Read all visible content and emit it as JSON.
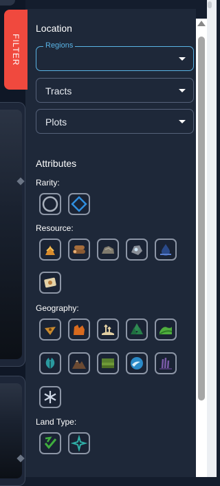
{
  "filter_tab": {
    "label": "FILTER"
  },
  "location": {
    "heading": "Location",
    "selects": [
      {
        "label": "Regions",
        "value": "",
        "active": true
      },
      {
        "label": "Tracts",
        "value": ""
      },
      {
        "label": "Plots",
        "value": ""
      }
    ]
  },
  "attributes": {
    "heading": "Attributes",
    "rarity": {
      "label": "Rarity:",
      "icons": [
        "circle-rarity-icon",
        "diamond-rarity-icon"
      ]
    },
    "resource": {
      "label": "Resource:",
      "icons": [
        "grain-icon",
        "logs-icon",
        "stone-icon",
        "ore-icon",
        "water-icon",
        "map-icon"
      ]
    },
    "geography": {
      "label": "Geography:",
      "icons": [
        "desert-icon",
        "canyon-icon",
        "oasis-icon",
        "forest-icon",
        "hills-icon",
        "jungle-icon",
        "mountains-icon",
        "plains-icon",
        "coast-icon",
        "swamp-icon",
        "tundra-icon"
      ]
    },
    "land_type": {
      "label": "Land Type:",
      "icons": [
        "check-land-icon",
        "star-land-icon"
      ]
    }
  },
  "colors": {
    "accent": "#5ab4e6",
    "filter_tab": "#f0493e",
    "panel": "#1e2839"
  }
}
